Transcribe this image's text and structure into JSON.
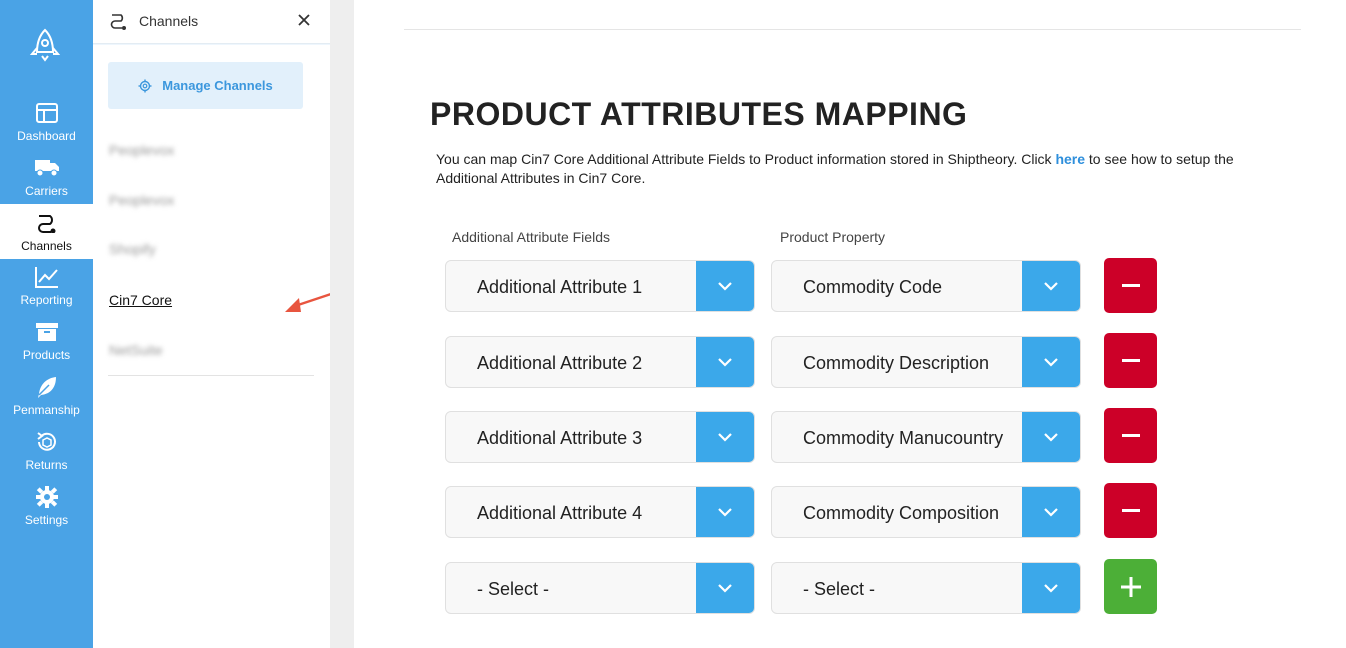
{
  "rail": {
    "items": [
      {
        "label": "Dashboard",
        "icon": "dashboard-icon"
      },
      {
        "label": "Carriers",
        "icon": "truck-icon"
      },
      {
        "label": "Channels",
        "icon": "channels-icon"
      },
      {
        "label": "Reporting",
        "icon": "chart-icon"
      },
      {
        "label": "Products",
        "icon": "box-icon"
      },
      {
        "label": "Penmanship",
        "icon": "feather-icon"
      },
      {
        "label": "Returns",
        "icon": "returns-icon"
      },
      {
        "label": "Settings",
        "icon": "gear-icon"
      }
    ]
  },
  "panel": {
    "title": "Channels",
    "manage_label": "Manage Channels",
    "channels": [
      "Peoplevox",
      "Peoplevox",
      "Shopify",
      "Cin7 Core",
      "NetSuite"
    ]
  },
  "main": {
    "title": "PRODUCT ATTRIBUTES MAPPING",
    "desc_before": "You can map Cin7 Core Additional Attribute Fields to Product information stored in Shiptheory. Click ",
    "desc_link": "here",
    "desc_after": " to see how to setup the Additional Attributes in Cin7 Core.",
    "col_left": "Additional Attribute Fields",
    "col_right": "Product Property",
    "rows": [
      {
        "field": "Additional Attribute 1",
        "property": "Commodity Code",
        "action": "remove"
      },
      {
        "field": "Additional Attribute 2",
        "property": "Commodity Description",
        "action": "remove"
      },
      {
        "field": "Additional Attribute 3",
        "property": "Commodity Manucountry",
        "action": "remove"
      },
      {
        "field": "Additional Attribute 4",
        "property": "Commodity Composition",
        "action": "remove"
      },
      {
        "field": "- Select -",
        "property": "- Select -",
        "action": "add"
      }
    ]
  },
  "colors": {
    "rail": "#4aa3e6",
    "dropdown": "#3ba8ea",
    "remove": "#cc0028",
    "add": "#4caf37",
    "link": "#2e8fdc"
  }
}
